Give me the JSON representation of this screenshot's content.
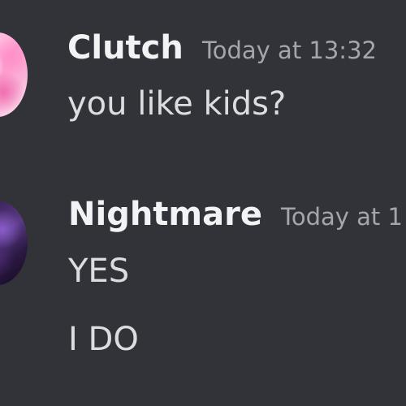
{
  "colors": {
    "background": "#313338",
    "username": "#f2f3f5",
    "timestamp": "#a3a6aa",
    "message_text": "#dbdee1"
  },
  "messages": [
    {
      "author": "Clutch",
      "timestamp": "Today at 13:32",
      "avatar_icon": "pink-swirl-avatar",
      "lines": [
        "you like kids?"
      ]
    },
    {
      "author": "Nightmare",
      "timestamp": "Today at 1",
      "avatar_icon": "purple-dark-avatar",
      "lines": [
        "YES",
        "I DO"
      ]
    }
  ]
}
